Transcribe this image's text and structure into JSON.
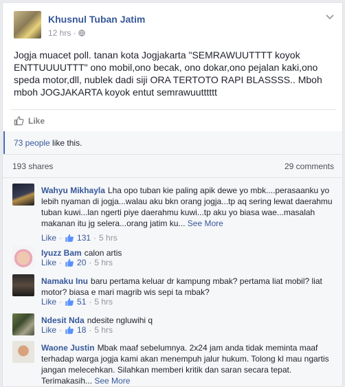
{
  "post": {
    "author": "Khusnul Tuban Jatim",
    "time": "12 hrs",
    "separator": "·",
    "privacy_icon": "globe-icon",
    "text": "Jogja muacet poll. tanan kota Jogjakarta \"SEMRAWUUTTTT koyok ENTTUUUUTTT\" ono mobil,ono becak, ono dokar,ono pejalan kaki,ono speda motor,dll, nublek dadi siji ORA TERTOTO RAPI BLASSSS.. Mboh mboh JOGJAKARTA koyok entut semrawuutttttt"
  },
  "actions": {
    "like_label": "Like"
  },
  "likes": {
    "count_text": "73 people",
    "suffix": " like this."
  },
  "stats": {
    "shares": "193 shares",
    "comments": "29 comments"
  },
  "comments": [
    {
      "name": "Wahyu Mikhayla",
      "text": "Lha opo tuban kie paling apik dewe yo mbk....perasaanku yo lebih nyaman di jogja...walau aku bkn orang jogja...tp aq sering lewat daerahmu tuban kuwi...lan ngerti piye daerahmu kuwi...tp aku yo biasa wae...masalah makanan itu jg selera...orang jatim ku...",
      "see_more": "See More",
      "like_label": "Like",
      "dot": "·",
      "likes": "131",
      "time": "5 hrs"
    },
    {
      "name": "Iyuzz Bam",
      "text": "calon artis",
      "like_label": "Like",
      "dot": "·",
      "likes": "20",
      "time": "5 hrs"
    },
    {
      "name": "Namaku Inu",
      "text": "baru pertama keluar dr kampung mbak? pertama liat mobil? liat motor? biasa e mari magrib wis sepi ta mbak?",
      "like_label": "Like",
      "dot": "·",
      "likes": "51",
      "time": "5 hrs"
    },
    {
      "name": "Ndesit Nda",
      "text": "ndesite ngluwihi q",
      "like_label": "Like",
      "dot": "·",
      "likes": "18",
      "time": "5 hrs"
    },
    {
      "name": "Waone Justin",
      "text": "Mbak maaf sebelumnya. 2x24 jam anda tidak meminta maaf terhadap warga jogja kami akan menempuh jalur hukum. Tolong kl mau ngartis jangan melecehkan. Silahkan memberi kritik dan saran secara tepat. Terimakasih...",
      "see_more": "See More"
    }
  ],
  "colors": {
    "link": "#365899",
    "meta": "#90949c",
    "accent": "#4267b2"
  }
}
